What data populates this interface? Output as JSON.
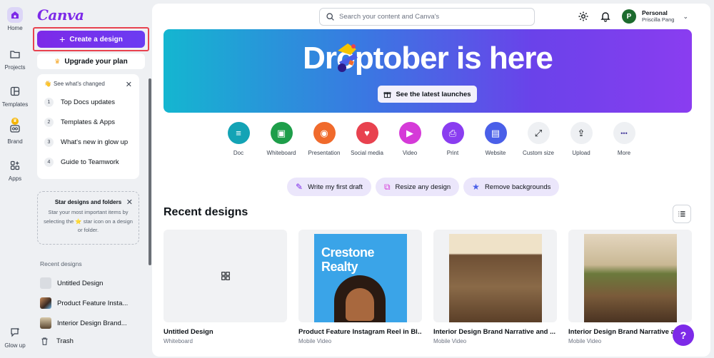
{
  "app": {
    "logo": "Canva"
  },
  "rail": [
    {
      "label": "Home",
      "icon": "home-icon",
      "active": true
    },
    {
      "label": "Projects",
      "icon": "folder-icon"
    },
    {
      "label": "Templates",
      "icon": "templates-icon"
    },
    {
      "label": "Brand",
      "icon": "brand-icon",
      "badge": "♛"
    },
    {
      "label": "Apps",
      "icon": "apps-icon"
    },
    {
      "label": "Glow up",
      "icon": "glow-up-icon"
    }
  ],
  "sidebar": {
    "create_label": "Create a design",
    "upgrade_label": "Upgrade your plan",
    "changes": {
      "title": "See what's changed",
      "items": [
        "Top Docs updates",
        "Templates & Apps",
        "What's new in glow up",
        "Guide to Teamwork"
      ]
    },
    "star": {
      "title": "Star designs and folders",
      "text": "Star your most important items by selecting the ⭐ star icon on a design or folder."
    },
    "recent_title": "Recent designs",
    "recent": [
      "Untitled Design",
      "Product Feature Insta...",
      "Interior Design Brand..."
    ],
    "trash_label": "Trash"
  },
  "header": {
    "search_placeholder": "Search your content and Canva's",
    "account_name": "Personal",
    "account_user": "Priscilla Pang",
    "avatar_letter": "P"
  },
  "hero": {
    "title": "Droptober is here",
    "button": "See the latest launches"
  },
  "categories": [
    {
      "label": "Doc",
      "color": "#13a3b5",
      "glyph": "≡"
    },
    {
      "label": "Whiteboard",
      "color": "#1e9e4a",
      "glyph": "▣"
    },
    {
      "label": "Presentation",
      "color": "#f06a2c",
      "glyph": "◉"
    },
    {
      "label": "Social media",
      "color": "#e8424f",
      "glyph": "♥"
    },
    {
      "label": "Video",
      "color": "#d53ad8",
      "glyph": "▶"
    },
    {
      "label": "Print",
      "color": "#8a3df0",
      "glyph": "⎙"
    },
    {
      "label": "Website",
      "color": "#4a5fe8",
      "glyph": "▤"
    },
    {
      "label": "Custom size",
      "color": "#eef0f3",
      "glyph": "⤢"
    },
    {
      "label": "Upload",
      "color": "#eef0f3",
      "glyph": "⇪"
    },
    {
      "label": "More",
      "color": "#eef0f3",
      "glyph": "•••"
    }
  ],
  "chips": [
    {
      "label": "Write my first draft",
      "icon": "magic-write-icon"
    },
    {
      "label": "Resize any design",
      "icon": "resize-icon"
    },
    {
      "label": "Remove backgrounds",
      "icon": "bg-remover-icon"
    }
  ],
  "recent_designs": {
    "title": "Recent designs",
    "cards": [
      {
        "name": "Untitled Design",
        "type": "Whiteboard"
      },
      {
        "name": "Product Feature Instagram Reel in Bl...",
        "type": "Mobile Video",
        "overlay": "Crestone Realty"
      },
      {
        "name": "Interior Design Brand Narrative and ...",
        "type": "Mobile Video"
      },
      {
        "name": "Interior Design Brand Narrative an...",
        "type": "Mobile Video"
      }
    ]
  },
  "help_label": "?"
}
